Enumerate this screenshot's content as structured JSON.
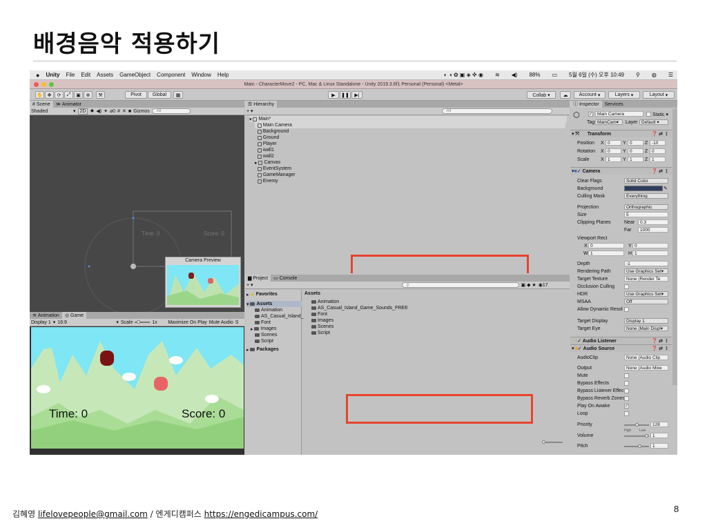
{
  "slide": {
    "title": "배경음악 적용하기",
    "footer_author": "김혜영",
    "footer_email": "lifelovepeople@gmail.com",
    "footer_sep": "/",
    "footer_org": "엔게디캠퍼스",
    "footer_url": "https://engedicampus.com/",
    "page_number": "8"
  },
  "menubar": {
    "apple": "",
    "app": "Unity",
    "items": [
      "File",
      "Edit",
      "Assets",
      "GameObject",
      "Component",
      "Window",
      "Help"
    ],
    "battery": "88%",
    "datetime": "5월 6일 (수) 오후 10:49"
  },
  "window_title": "Main - CharacterMove2 - PC, Mac & Linux Standalone - Unity 2019.3.6f1 Personal (Personal) <Metal>",
  "toolbar": {
    "pivot": "Pivot",
    "global": "Global",
    "collab": "Collab ▾",
    "account": "Account",
    "layers": "Layers",
    "layout": "Layout"
  },
  "scene": {
    "tab_scene": "Scene",
    "tab_animator": "Animator",
    "shading": "Shaded",
    "mode_2d": "2D",
    "gizmos": "Gizmos",
    "search": "All",
    "game_time_ghost": "Time: 0",
    "game_score_ghost": "Score: 0",
    "camera_preview": "Camera Preview"
  },
  "game": {
    "tab_animation": "Animation",
    "tab_game": "Game",
    "display": "Display 1",
    "aspect": "16:9",
    "scale_label": "Scale",
    "scale_value": "1x",
    "maximize": "Maximize On Play",
    "mute": "Mute Audio",
    "stats": "S",
    "time_text": "Time: 0",
    "score_text": "Score: 0"
  },
  "hierarchy": {
    "tab": "Hierarchy",
    "search": "All",
    "scene_name": "Main*",
    "items": [
      "Main Camera",
      "Background",
      "Ground",
      "Player",
      "wall1",
      "wall2",
      "Canvas",
      "EventSystem",
      "GameManager",
      "Enemy"
    ]
  },
  "project": {
    "tab_project": "Project",
    "tab_console": "Console",
    "favorites": "Favorites",
    "assets": "Assets",
    "tree": [
      "Animation",
      "AS_Casual_Island_",
      "Font",
      "Images",
      "Scenes",
      "Script"
    ],
    "packages": "Packages",
    "assets_header": "Assets",
    "files": [
      "Animation",
      "AS_Casual_Island_Game_Sounds_FREE",
      "Font",
      "Images",
      "Scenes",
      "Script"
    ],
    "count": "17"
  },
  "inspector": {
    "tab_inspector": "Inspector",
    "tab_services": "Services",
    "object_name": "Main Camera",
    "static": "Static",
    "tag_label": "Tag",
    "tag_value": "MainCam▾",
    "layer_label": "Layer",
    "layer_value": "Default",
    "transform": {
      "title": "Transform",
      "rows": [
        {
          "label": "Position",
          "x": "0",
          "y": "0",
          "z": "-10"
        },
        {
          "label": "Rotation",
          "x": "0",
          "y": "0",
          "z": "0"
        },
        {
          "label": "Scale",
          "x": "1",
          "y": "1",
          "z": "1"
        }
      ]
    },
    "camera": {
      "title": "Camera",
      "clear_flags_label": "Clear Flags",
      "clear_flags": "Solid Color",
      "background_label": "Background",
      "background_color": "#2f3e5e",
      "culling_label": "Culling Mask",
      "culling": "Everything",
      "projection_label": "Projection",
      "projection": "Orthographic",
      "size_label": "Size",
      "size": "5",
      "clipping_label": "Clipping Planes",
      "near_label": "Near",
      "near": "0.3",
      "far_label": "Far",
      "far": "1000",
      "viewport_label": "Viewport Rect",
      "vx": "0",
      "vy": "0",
      "vw": "1",
      "vh": "1",
      "depth_label": "Depth",
      "depth": "-1",
      "rendering_label": "Rendering Path",
      "rendering": "Use Graphics Set▾",
      "target_texture_label": "Target Texture",
      "target_texture": "None (Render Te",
      "occlusion_label": "Occlusion Culling",
      "hdr_label": "HDR",
      "hdr": "Use Graphics Set▾",
      "msaa_label": "MSAA",
      "msaa": "Off",
      "dynres_label": "Allow Dynamic Resol",
      "target_display_label": "Target Display",
      "target_display": "Display 1",
      "target_eye_label": "Target Eye",
      "target_eye": "None (Main Displ▾"
    },
    "audio_listener": "Audio Listener",
    "audio_source": {
      "title": "Audio Source",
      "clip_label": "AudioClip",
      "clip": "None (Audio Clip",
      "output_label": "Output",
      "output": "None (Audio Mixe",
      "mute_label": "Mute",
      "bypass_effects": "Bypass Effects",
      "bypass_listener": "Bypass Listener Effec",
      "bypass_reverb": "Bypass Reverb Zones",
      "play_on_awake": "Play On Awake",
      "loop": "Loop",
      "priority_label": "Priority",
      "priority": "128",
      "high": "High",
      "low": "Low",
      "volume_label": "Volume",
      "volume": "1",
      "pitch_label": "Pitch",
      "pitch": "1"
    }
  },
  "colors": {
    "highlight_red": "#e8432d",
    "sky": "#7ee6f4",
    "hills_light": "#bfe3b0",
    "ground": "#9bd58a"
  }
}
